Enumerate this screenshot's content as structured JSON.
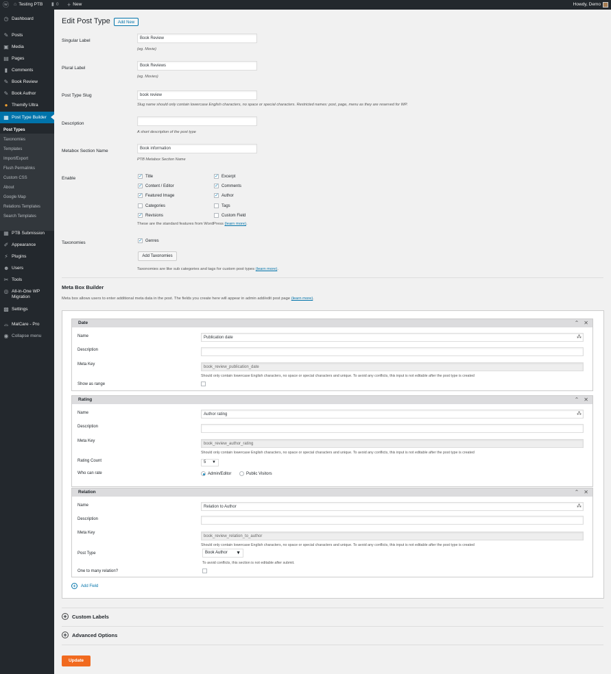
{
  "adminbar": {
    "site_name": "Testing PTB",
    "comments_count": "0",
    "new_label": "New",
    "howdy": "Howdy, Demo"
  },
  "sidebar": {
    "items": [
      {
        "label": "Dashboard",
        "icon": "dashboard-icon"
      },
      {
        "label": "Posts",
        "icon": "pin-icon"
      },
      {
        "label": "Media",
        "icon": "media-icon"
      },
      {
        "label": "Pages",
        "icon": "page-icon"
      },
      {
        "label": "Comments",
        "icon": "comment-icon"
      },
      {
        "label": "Book Review",
        "icon": "pin-icon"
      },
      {
        "label": "Book Author",
        "icon": "pin-icon"
      },
      {
        "label": "Themify Ultra",
        "icon": "themify-icon"
      },
      {
        "label": "Post Type Builder",
        "icon": "edit-icon"
      },
      {
        "label": "PTB Submission",
        "icon": "edit-icon"
      },
      {
        "label": "Appearance",
        "icon": "brush-icon"
      },
      {
        "label": "Plugins",
        "icon": "plugin-icon"
      },
      {
        "label": "Users",
        "icon": "users-icon"
      },
      {
        "label": "Tools",
        "icon": "wrench-icon"
      },
      {
        "label": "All-in-One WP",
        "label2": "Migration",
        "icon": "migration-icon"
      },
      {
        "label": "Settings",
        "icon": "settings-icon"
      },
      {
        "label": "MalCare - Pro",
        "icon": "malcare-icon"
      },
      {
        "label": "Collapse menu",
        "icon": "collapse-icon"
      }
    ],
    "submenu": [
      "Post Types",
      "Taxonomies",
      "Templates",
      "Import/Export",
      "Flush Permalinks",
      "Custom CSS",
      "About",
      "Google Map",
      "Relations Templates",
      "Search Templates"
    ]
  },
  "page": {
    "title": "Edit Post Type",
    "add_new": "Add New"
  },
  "form": {
    "singular_label": "Singular Label",
    "singular_value": "Book Review",
    "singular_hint": "(eg. Movie)",
    "plural_label": "Plural Label",
    "plural_value": "Book Reviews",
    "plural_hint": "(eg. Movies)",
    "slug_label": "Post Type Slug",
    "slug_value": "book review",
    "slug_hint": "Slug name should only contain lowercase English characters, no space or special characters. Restricted names: post, page, menu as they are reserved for WP.",
    "desc_label": "Description",
    "desc_value": "",
    "desc_hint": "A short description of the post type",
    "metabox_label": "Metabox Section Name",
    "metabox_value": "Book information",
    "metabox_hint": "PTB Metabox Section Name",
    "enable_label": "Enable",
    "features_left": [
      {
        "label": "Title",
        "checked": true
      },
      {
        "label": "Content / Editor",
        "checked": true
      },
      {
        "label": "Featured Image",
        "checked": true
      },
      {
        "label": "Categories",
        "checked": false
      },
      {
        "label": "Revisions",
        "checked": true
      }
    ],
    "features_right": [
      {
        "label": "Excerpt",
        "checked": true
      },
      {
        "label": "Comments",
        "checked": true
      },
      {
        "label": "Author",
        "checked": true
      },
      {
        "label": "Tags",
        "checked": false
      },
      {
        "label": "Custom Field",
        "checked": false
      }
    ],
    "features_hint": "These are the standard features from WordPress",
    "learn_more": "(learn more)",
    "taxonomies_label": "Taxonomies",
    "tax_genres": "Genres",
    "add_taxonomies": "Add Taxonomies",
    "taxonomies_hint": "Taxonomies are like sub categories and tags for custom post types"
  },
  "metabox_builder": {
    "title": "Meta Box Builder",
    "desc": "Meta box allows users to enter additional meta data in the post. The fields you create here will appear in admin add/edit post page",
    "learn_more": "(learn more)",
    "name_label": "Name",
    "description_label": "Description",
    "metakey_label": "Meta Key",
    "metakey_hint": "Should only contain lowercase English characters, no space or special characters and unique. To avoid any conflicts, this input is not editable after the post type is created",
    "date": {
      "title": "Date",
      "name_value": "Publication date",
      "metakey_value": "book_review_publication_date",
      "show_as_range": "Show as range"
    },
    "rating": {
      "title": "Rating",
      "name_value": "Author rating",
      "metakey_value": "book_review_author_rating",
      "rating_count_label": "Rating Count",
      "rating_count_value": "5",
      "who_can_rate": "Who can rate",
      "opt_admin": "Admin/Editor",
      "opt_public": "Public Visitors"
    },
    "relation": {
      "title": "Relation",
      "name_value": "Relation to Author",
      "metakey_value": "book_review_relation_to_author",
      "post_type_label": "Post Type",
      "post_type_value": "Book Author",
      "post_type_hint": "To avoid conflicts, this section is not editable after submit.",
      "one_to_many": "One to many relation?"
    },
    "add_field": "Add Field"
  },
  "sections": {
    "custom_labels": "Custom Labels",
    "advanced_options": "Advanced Options"
  },
  "update": "Update",
  "colors": {
    "accent": "#0073aa",
    "update": "#f16a1f",
    "admin_bg": "#23282d"
  }
}
